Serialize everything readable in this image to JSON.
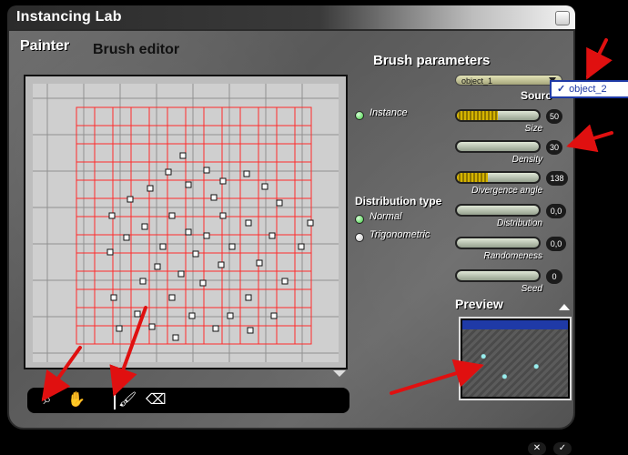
{
  "window": {
    "title": "Instancing Lab"
  },
  "tabs": {
    "painter": "Painter",
    "brush_editor": "Brush editor"
  },
  "brush_parameters": {
    "title": "Brush parameters",
    "object_dropdown_value": "object_1",
    "object_popup_value": "object_2",
    "source_label": "Sourc",
    "instance_label": "Instance",
    "distribution_title": "Distribution type",
    "distribution_normal": "Normal",
    "distribution_trigonometric": "Trigonometric",
    "sliders": [
      {
        "label": "Size",
        "value": "50",
        "level": 0.5
      },
      {
        "label": "Density",
        "value": "30",
        "level": 0.0
      },
      {
        "label": "Divergence angle",
        "value": "138",
        "level": 0.38
      },
      {
        "label": "Distribution",
        "value": "0,0",
        "level": 0.0
      },
      {
        "label": "Randomeness",
        "value": "0,0",
        "level": 0.0
      },
      {
        "label": "Seed",
        "value": "0",
        "level": 0.0
      }
    ]
  },
  "preview": {
    "title": "Preview"
  },
  "icons": {
    "close_title": "close-icon",
    "toolbar": [
      "zoom-icon",
      "hand-icon",
      "brush-icon",
      "eraser-icon"
    ],
    "cancel": "cancel-icon",
    "ok": "ok-icon"
  },
  "colors": {
    "grid_red": "#ff2b2b",
    "grid_gray": "#8a8a8a",
    "arrow_red": "#e01010"
  }
}
